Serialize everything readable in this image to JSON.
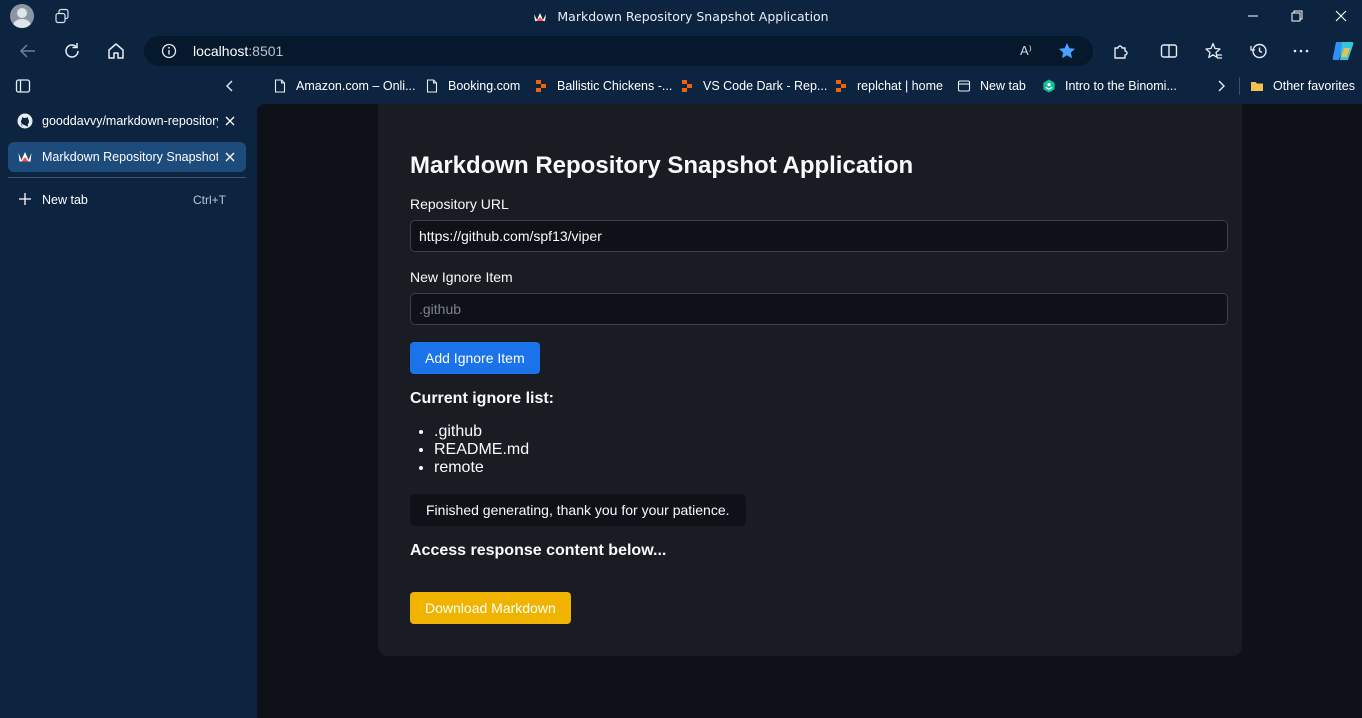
{
  "window": {
    "title": "Markdown Repository Snapshot Application"
  },
  "addressbar": {
    "host": "localhost",
    "port": ":8501",
    "read_aloud": "A⁾"
  },
  "bookmarks": [
    {
      "label": "Amazon.com – Onli...",
      "icon": "page-icon"
    },
    {
      "label": "Booking.com",
      "icon": "page-icon"
    },
    {
      "label": "Ballistic Chickens -...",
      "icon": "replit-icon"
    },
    {
      "label": "VS Code Dark - Rep...",
      "icon": "replit-icon"
    },
    {
      "label": "replchat | home",
      "icon": "replit-icon"
    },
    {
      "label": "New tab",
      "icon": "newtab-icon"
    },
    {
      "label": "Intro to the Binomi...",
      "icon": "khan-icon"
    },
    {
      "label": "Other favorites",
      "icon": "folder-icon"
    }
  ],
  "tabs": [
    {
      "label": "gooddavvy/markdown-repository",
      "icon": "github-icon",
      "active": false
    },
    {
      "label": "Markdown Repository Snapshot A",
      "icon": "streamlit-icon",
      "active": true
    }
  ],
  "new_tab": {
    "label": "New tab",
    "shortcut": "Ctrl+T"
  },
  "app": {
    "title": "Markdown Repository Snapshot Application",
    "repo_label": "Repository URL",
    "repo_value": "https://github.com/spf13/viper",
    "ignore_label": "New Ignore Item",
    "ignore_placeholder": ".github",
    "add_button": "Add Ignore Item",
    "current_list_heading": "Current ignore list:",
    "ignore_items": [
      ".github",
      "README.md",
      "remote"
    ],
    "status": "Finished generating, thank you for your patience.",
    "response_heading": "Access response content below...",
    "download_button": "Download Markdown"
  },
  "colors": {
    "chrome": "#0c2440",
    "page_bg": "#0e1117",
    "card_bg": "#1a1c24",
    "primary_button": "#1a73e8",
    "download_button": "#f0b400"
  }
}
